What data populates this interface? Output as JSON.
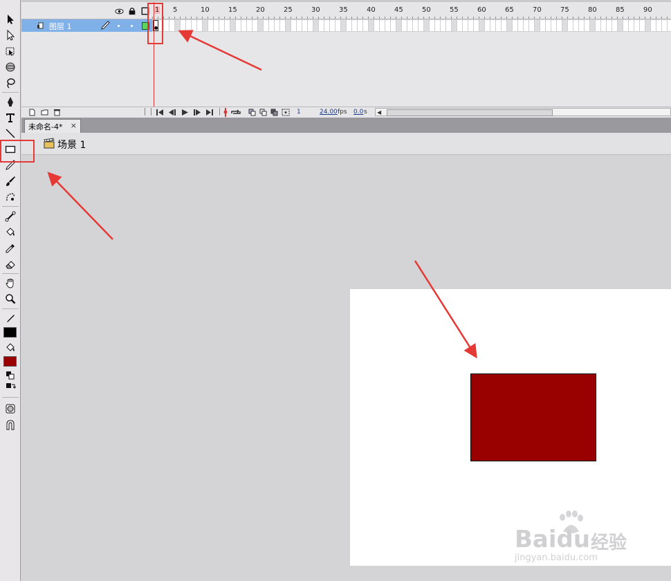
{
  "timeline": {
    "ruler_ticks": [
      "1",
      "5",
      "10",
      "15",
      "20",
      "25",
      "30",
      "35",
      "40",
      "45",
      "50",
      "55",
      "60",
      "65",
      "70",
      "75",
      "80",
      "85",
      "90"
    ],
    "layer_name": "图层 1",
    "status": {
      "frame": "1",
      "fps": "24.00",
      "fps_unit": "fps",
      "time": "0.0",
      "time_unit": "s"
    }
  },
  "document": {
    "tab_title": "未命名-4*",
    "tab_close": "×",
    "scene": "场景 1"
  },
  "colors": {
    "stroke": "#000000",
    "fill": "#990000",
    "rect_fill": "#990000",
    "layer_highlight": "#7fb0e8",
    "annotation": "#e53935"
  },
  "watermark": {
    "brand": "Baidu",
    "cn": "经验",
    "url": "jingyan.baidu.com"
  },
  "tools": [
    "selection-icon",
    "subselection-icon",
    "free-transform-icon",
    "3d-rotation-icon",
    "lasso-icon",
    "pen-icon",
    "text-icon",
    "line-icon",
    "rectangle-icon",
    "pencil-icon",
    "brush-icon",
    "deco-icon",
    "bone-icon",
    "paint-bucket-icon",
    "eyedropper-icon",
    "eraser-icon",
    "hand-icon",
    "zoom-icon"
  ]
}
